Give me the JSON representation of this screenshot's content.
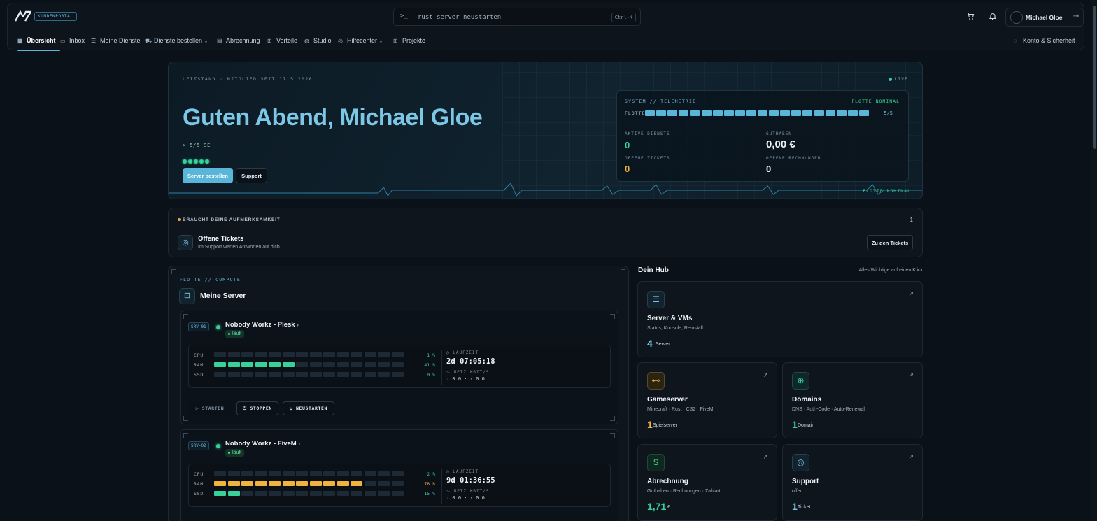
{
  "header": {
    "logo": "AV",
    "portal_badge": "KUNDENPORTAL",
    "search": {
      "prompt": ">_",
      "value": "rust server neustarten",
      "shortcut": "Ctrl+K"
    },
    "user": {
      "name": "Michael Gloe"
    }
  },
  "nav": {
    "items": [
      {
        "label": "Übersicht",
        "icon": "grid-icon"
      },
      {
        "label": "Inbox",
        "icon": "inbox-icon"
      },
      {
        "label": "Meine Dienste",
        "icon": "server-icon"
      },
      {
        "label": "Dienste bestellen",
        "icon": "cart-icon"
      },
      {
        "label": "Abrechnung",
        "icon": "receipt-icon"
      },
      {
        "label": "Vorteile",
        "icon": "gift-icon"
      },
      {
        "label": "Studio",
        "icon": "palette-icon"
      },
      {
        "label": "Hilfecenter",
        "icon": "help-icon"
      },
      {
        "label": "Projekte",
        "icon": "apps-icon"
      }
    ],
    "account": "Konto & Sicherheit"
  },
  "hero": {
    "eyebrow": "LEITSTAND · MITGLIED SEIT 17.5.2026",
    "live": "LIVE",
    "greeting": "Guten Abend, Michael Gloe",
    "se": "> 5/5 SE",
    "order_button": "Server bestellen",
    "support_button": "Support",
    "footer": "FLOTTE NOMINAL",
    "telemetry": {
      "title": "SYSTEM // TELEMETRIE",
      "status": "FLOTTE NOMINAL",
      "fleet_label": "FLOTTE",
      "fleet_count": "5/5",
      "active_label": "AKTIVE DIENSTE",
      "active_value": "0",
      "credit_label": "GUTHABEN",
      "credit_value": "0,00 €",
      "tickets_label": "OFFENE TICKETS",
      "tickets_value": "0",
      "invoices_label": "OFFENE RECHNUNGEN",
      "invoices_value": "0"
    }
  },
  "attention": {
    "label": "BRAUCHT DEINE AUFMERKSAMKEIT",
    "count": "1",
    "title": "Offene Tickets",
    "subtitle": "Im Support warten Antworten auf dich.",
    "button": "Zu den Tickets"
  },
  "servers": {
    "eyebrow": "FLOTTE // COMPUTE",
    "title": "Meine Server",
    "items": [
      {
        "tag": "SRV-01",
        "name": "Nobody Workz - Plesk",
        "status": "läuft",
        "cpu_label": "CPU",
        "cpu": "1 %",
        "cpu_level": 0.01,
        "ram_label": "RAM",
        "ram": "41 %",
        "ram_level": 0.41,
        "ssd_label": "SSD",
        "ssd": "0 %",
        "ssd_level": 0.0,
        "uptime_label": "LAUFZEIT",
        "uptime": "2d 07:05:18",
        "net_label": "NETZ MBIT/S",
        "net": "↓ 0.0 · ↑ 0.0",
        "start": "STARTEN",
        "stop": "STOPPEN",
        "restart": "NEUSTARTEN"
      },
      {
        "tag": "SRV-02",
        "name": "Nobody Workz - FiveM",
        "status": "läuft",
        "cpu_label": "CPU",
        "cpu": "2 %",
        "cpu_level": 0.02,
        "ram_label": "RAM",
        "ram": "78 %",
        "ram_level": 0.78,
        "ssd_label": "SSD",
        "ssd": "15 %",
        "ssd_level": 0.15,
        "uptime_label": "LAUFZEIT",
        "uptime": "9d 01:36:55",
        "net_label": "NETZ MBIT/S",
        "net": "↓ 0.0 · ↑ 0.0"
      }
    ]
  },
  "hub": {
    "title": "Dein Hub",
    "subtitle": "Alles Wichtige auf einen Klick",
    "cards": {
      "server": {
        "title": "Server & VMs",
        "sub": "Status, Konsole, Reinstall",
        "count": "4",
        "unit": "Server"
      },
      "games": {
        "title": "Gameserver",
        "sub": "Minecraft · Rust · CS2 · FiveM",
        "count": "1",
        "unit": "Spielserver"
      },
      "domains": {
        "title": "Domains",
        "sub": "DNS · Auth-Code · Auto-Renewal",
        "count": "1",
        "unit": "Domain"
      },
      "billing": {
        "title": "Abrechnung",
        "sub": "Guthaben · Rechnungen · Zahlart",
        "count": "1,71",
        "unit": "€"
      },
      "support": {
        "title": "Support",
        "sub": "offen",
        "count": "1",
        "unit": "Ticket"
      }
    }
  },
  "colors": {
    "accent": "#5ab6d9",
    "green": "#36d29a",
    "amber": "#f0b43c",
    "bg": "#0b1118"
  }
}
